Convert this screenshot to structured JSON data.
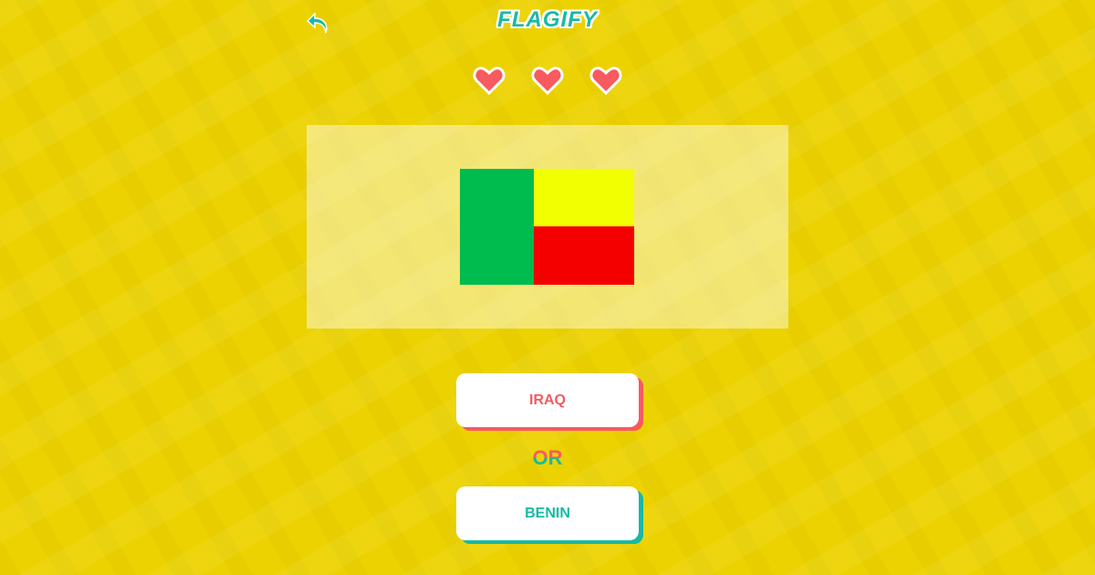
{
  "header": {
    "title": "FLAGIFY",
    "back_icon": "undo-arrow-icon"
  },
  "lives": {
    "count": 3,
    "max": 3,
    "color": "#f75a5f"
  },
  "flag": {
    "colors": {
      "green": "#00bb4e",
      "yellow": "#f2ff00",
      "red": "#f50000"
    }
  },
  "choices": [
    {
      "label": "IRAQ",
      "color": "#f75a5f"
    },
    {
      "label": "BENIN",
      "color": "#17b9a2"
    }
  ],
  "separator": "OR"
}
